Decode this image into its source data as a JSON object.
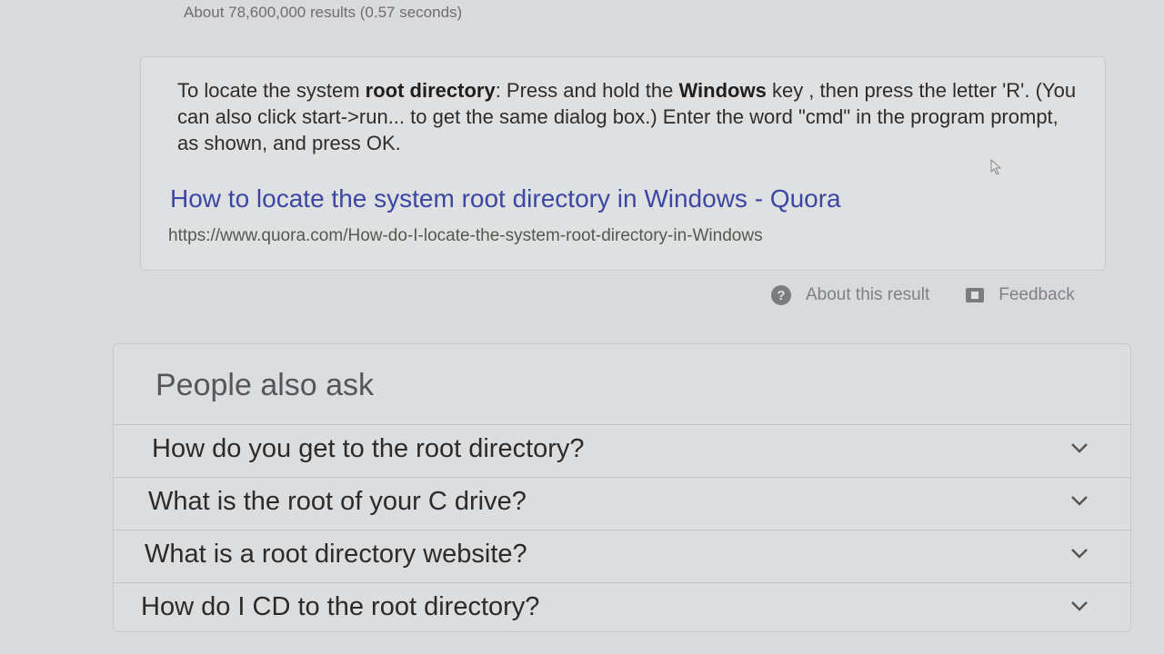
{
  "stats": "About 78,600,000 results (0.57 seconds)",
  "snippet": {
    "parts": [
      {
        "text": "To locate the system ",
        "bold": false
      },
      {
        "text": "root directory",
        "bold": true
      },
      {
        "text": ": Press and hold the ",
        "bold": false
      },
      {
        "text": "Windows",
        "bold": true
      },
      {
        "text": " key , then press the letter 'R'. (You can also click start->run... to get the same dialog box.) Enter the word \"cmd\" in the program prompt, as shown, and press OK.",
        "bold": false
      }
    ],
    "result_title": "How to locate the system root directory in Windows - Quora",
    "result_url": "https://www.quora.com/How-do-I-locate-the-system-root-directory-in-Windows"
  },
  "about_row": {
    "about_label": "About this result",
    "feedback_label": "Feedback",
    "about_icon": "help-circle-icon",
    "feedback_icon": "feedback-icon"
  },
  "people_also_ask": {
    "heading": "People also ask",
    "questions": [
      "How do you get to the root directory?",
      "What is the root of your C drive?",
      "What is a root directory website?",
      "How do I CD to the root directory?"
    ]
  },
  "colors": {
    "link": "#3b47a3",
    "url": "#505a50",
    "background": "#d9dadb"
  }
}
